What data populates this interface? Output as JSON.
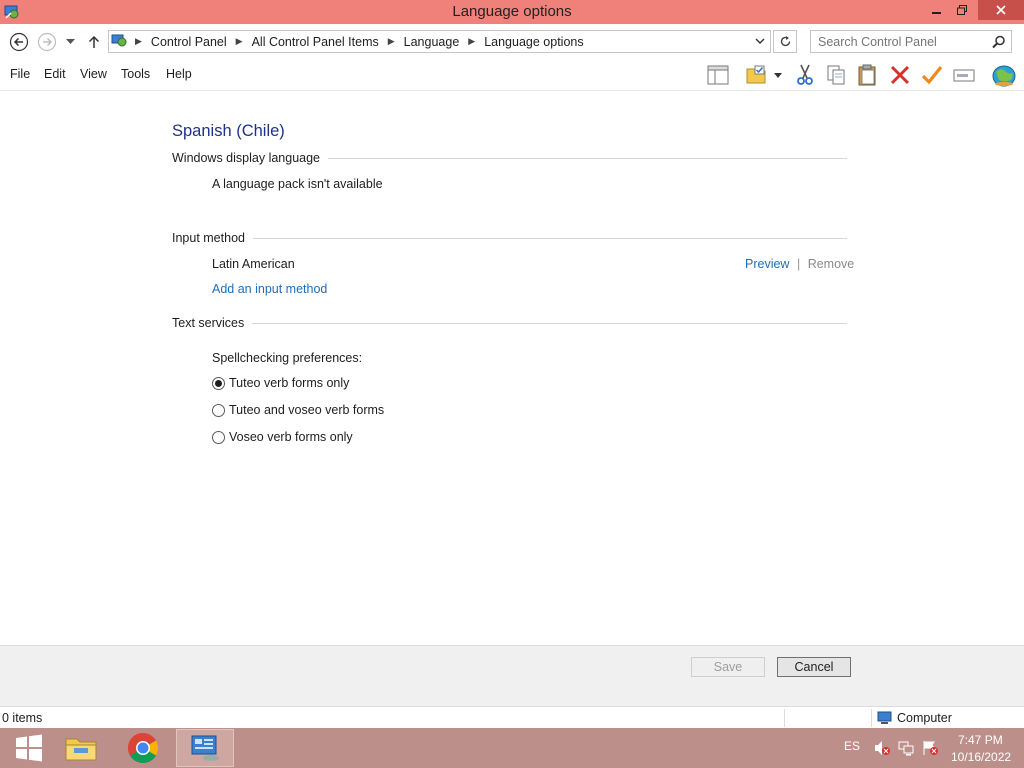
{
  "window": {
    "title": "Language options"
  },
  "address": {
    "crumbs": [
      "Control Panel",
      "All Control Panel Items",
      "Language",
      "Language options"
    ],
    "search_placeholder": "Search Control Panel"
  },
  "menu": {
    "items": [
      "File",
      "Edit",
      "View",
      "Tools",
      "Help"
    ]
  },
  "content": {
    "language_heading": "Spanish (Chile)",
    "display_language": {
      "title": "Windows display language",
      "status": "A language pack isn't available"
    },
    "input_method": {
      "title": "Input method",
      "method_name": "Latin American",
      "preview_label": "Preview",
      "separator": "|",
      "remove_label": "Remove",
      "add_label": "Add an input method"
    },
    "text_services": {
      "title": "Text services",
      "spellcheck_label": "Spellchecking preferences:",
      "options": [
        {
          "label": "Tuteo verb forms only",
          "checked": true
        },
        {
          "label": "Tuteo and voseo verb forms",
          "checked": false
        },
        {
          "label": "Voseo verb forms only",
          "checked": false
        }
      ]
    }
  },
  "footer": {
    "save_label": "Save",
    "cancel_label": "Cancel"
  },
  "statusbar": {
    "items_count": "0 items",
    "location": "Computer"
  },
  "taskbar": {
    "language": "ES",
    "time": "7:47 PM",
    "date": "10/16/2022"
  },
  "colors": {
    "titlebar": "#f0807a",
    "taskbar": "#bd8f8a",
    "link": "#1e6fb8",
    "heading": "#1e3287"
  }
}
